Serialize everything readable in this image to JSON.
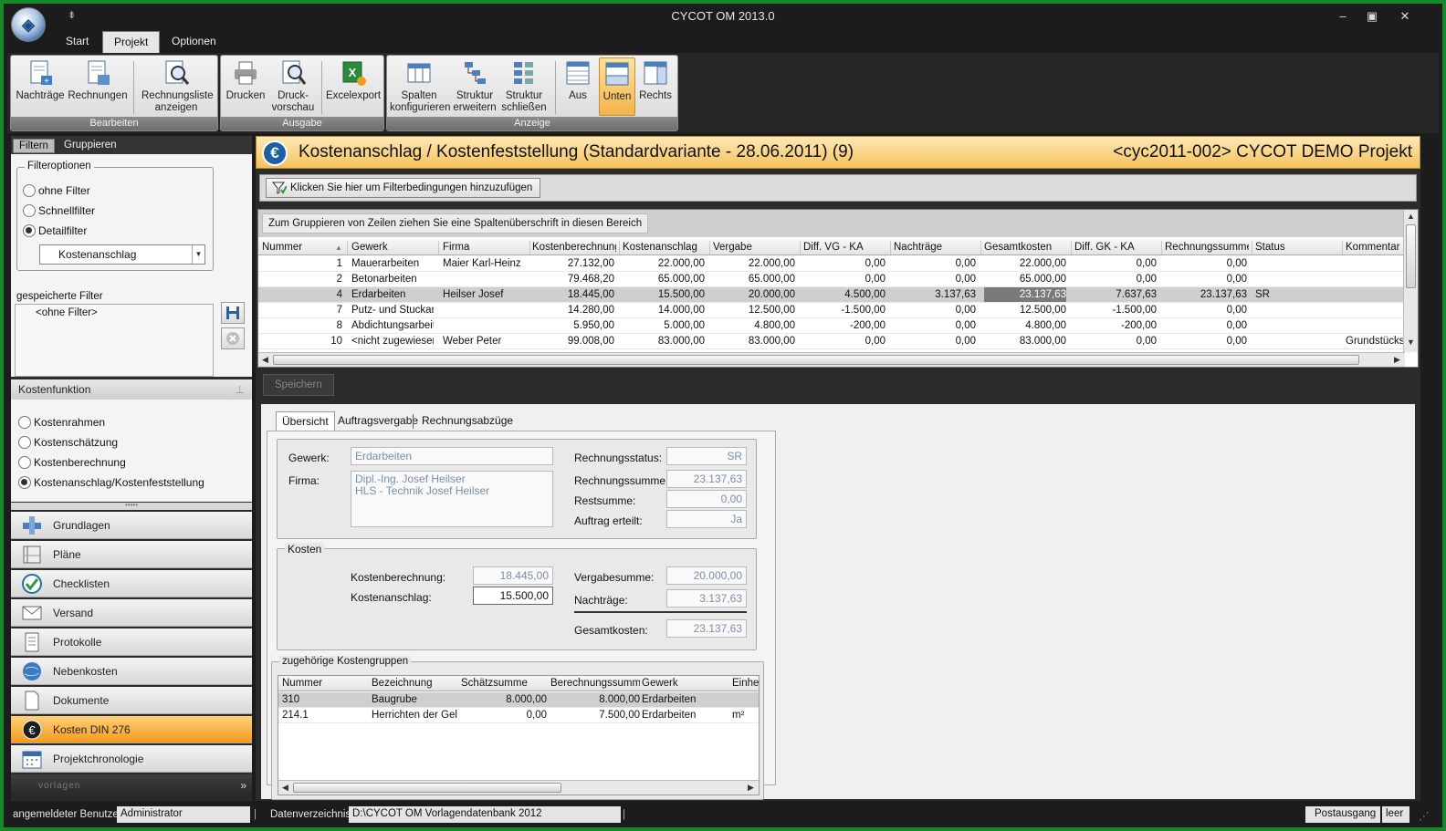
{
  "app": {
    "title": "CYCOT OM 2013.0"
  },
  "menu_tabs": [
    "Start",
    "Projekt",
    "Optionen"
  ],
  "ribbon": {
    "groups": [
      {
        "title": "Bearbeiten",
        "buttons": [
          "Nachträge",
          "Rechnungen",
          "Rechnungsliste anzeigen"
        ]
      },
      {
        "title": "Ausgabe",
        "buttons": [
          "Drucken",
          "Druck-\nvorschau",
          "Excelexport"
        ]
      },
      {
        "title": "Anzeige",
        "buttons": [
          "Spalten konfigurieren",
          "Struktur erweitern",
          "Struktur schließen",
          "Aus",
          "Unten",
          "Rechts"
        ]
      }
    ],
    "active_button": "Unten"
  },
  "left": {
    "tabs": [
      "Filtern",
      "Gruppieren"
    ],
    "filteroptionen": {
      "legend": "Filteroptionen",
      "options": [
        "ohne Filter",
        "Schnellfilter",
        "Detailfilter"
      ],
      "selected": "Detailfilter",
      "combo_value": "Kostenanschlag"
    },
    "saved_filter_label": "gespeicherte Filter",
    "saved_filter_items": [
      "<ohne Filter>"
    ],
    "kostenfunktion": {
      "title": "Kostenfunktion",
      "options": [
        "Kostenrahmen",
        "Kostenschätzung",
        "Kostenberechnung",
        "Kostenanschlag/Kostenfeststellung"
      ],
      "selected": "Kostenanschlag/Kostenfeststellung"
    },
    "nav": [
      "Grundlagen",
      "Pläne",
      "Checklisten",
      "Versand",
      "Protokolle",
      "Nebenkosten",
      "Dokumente",
      "Kosten DIN 276",
      "Projektchronologie"
    ],
    "nav_active": "Kosten DIN 276",
    "nav_footer": "vorlagen"
  },
  "header": {
    "title": "Kostenanschlag / Kostenfeststellung (Standardvariante - 28.06.2011) (9)",
    "project": "<cyc2011-002> CYCOT DEMO Projekt"
  },
  "filter_button": "Klicken Sie hier um Filterbedingungen hinzuzufügen",
  "group_hint": "Zum Gruppieren von Zeilen ziehen Sie eine Spaltenüberschrift in diesen Bereich",
  "grid": {
    "columns": [
      "Nummer",
      "Gewerk",
      "Firma",
      "Kostenberechnung",
      "Kostenanschlag",
      "Vergabe",
      "Diff. VG - KA",
      "Nachträge",
      "Gesamtkosten",
      "Diff. GK - KA",
      "Rechnungssumme",
      "Status",
      "Kommentar"
    ],
    "rows": [
      [
        "1",
        "Mauerarbeiten",
        "Maier Karl-Heinz",
        "27.132,00",
        "22.000,00",
        "22.000,00",
        "0,00",
        "0,00",
        "22.000,00",
        "0,00",
        "0,00",
        "",
        ""
      ],
      [
        "2",
        "Betonarbeiten",
        "",
        "79.468,20",
        "65.000,00",
        "65.000,00",
        "0,00",
        "0,00",
        "65.000,00",
        "0,00",
        "0,00",
        "",
        ""
      ],
      [
        "4",
        "Erdarbeiten",
        "Heilser Josef",
        "18.445,00",
        "15.500,00",
        "20.000,00",
        "4.500,00",
        "3.137,63",
        "23.137,63",
        "7.637,63",
        "23.137,63",
        "SR",
        ""
      ],
      [
        "7",
        "Putz- und Stuckarbe",
        "",
        "14.280,00",
        "14.000,00",
        "12.500,00",
        "-1.500,00",
        "0,00",
        "12.500,00",
        "-1.500,00",
        "0,00",
        "",
        ""
      ],
      [
        "8",
        "Abdichtungsarbeite",
        "",
        "5.950,00",
        "5.000,00",
        "4.800,00",
        "-200,00",
        "0,00",
        "4.800,00",
        "-200,00",
        "0,00",
        "",
        ""
      ],
      [
        "10",
        "<nicht zugewiesen>",
        "Weber Peter",
        "99.008,00",
        "83.000,00",
        "83.000,00",
        "0,00",
        "0,00",
        "83.000,00",
        "0,00",
        "0,00",
        "",
        "Grundstücksk"
      ]
    ],
    "selected_row": 2
  },
  "save_button": "Speichern",
  "detail": {
    "tabs": [
      "Übersicht",
      "Auftragsvergabe",
      "Rechnungsabzüge"
    ],
    "gewerk_label": "Gewerk:",
    "gewerk": "Erdarbeiten",
    "firma_label": "Firma:",
    "firma_lines": [
      "Dipl.-Ing. Josef Heilser",
      "HLS - Technik Josef Heilser"
    ],
    "rechnungsstatus_label": "Rechnungsstatus:",
    "rechnungsstatus": "SR",
    "rechnungssumme_label": "Rechnungssumme:",
    "rechnungssumme": "23.137,63",
    "restsumme_label": "Restsumme:",
    "restsumme": "0,00",
    "auftrag_label": "Auftrag erteilt:",
    "auftrag": "Ja",
    "kosten_legend": "Kosten",
    "kostenberechnung_label": "Kostenberechnung:",
    "kostenberechnung": "18.445,00",
    "kostenanschlag_label": "Kostenanschlag:",
    "kostenanschlag": "15.500,00",
    "vergabesumme_label": "Vergabesumme:",
    "vergabesumme": "20.000,00",
    "nachtraege_label": "Nachträge:",
    "nachtraege": "3.137,63",
    "gesamtkosten_label": "Gesamtkosten:",
    "gesamtkosten": "23.137,63",
    "kg_legend": "zugehörige Kostengruppen",
    "kg_columns": [
      "Nummer",
      "Bezeichnung",
      "Schätzsumme",
      "Berechnungssumm",
      "Gewerk",
      "Einhei"
    ],
    "kg_rows": [
      [
        "310",
        "Baugrube",
        "8.000,00",
        "8.000,00",
        "Erdarbeiten",
        ""
      ],
      [
        "214.1",
        "Herrichten der Gelä",
        "0,00",
        "7.500,00",
        "Erdarbeiten",
        "m²"
      ]
    ]
  },
  "status": {
    "user_label": "angemeldeter Benutzer",
    "user": "Administrator",
    "dir_label": "Datenverzeichnis",
    "dir": "D:\\CYCOT OM Vorlagendatenbank 2012",
    "postausgang": "Postausgang",
    "leer": "leer"
  }
}
